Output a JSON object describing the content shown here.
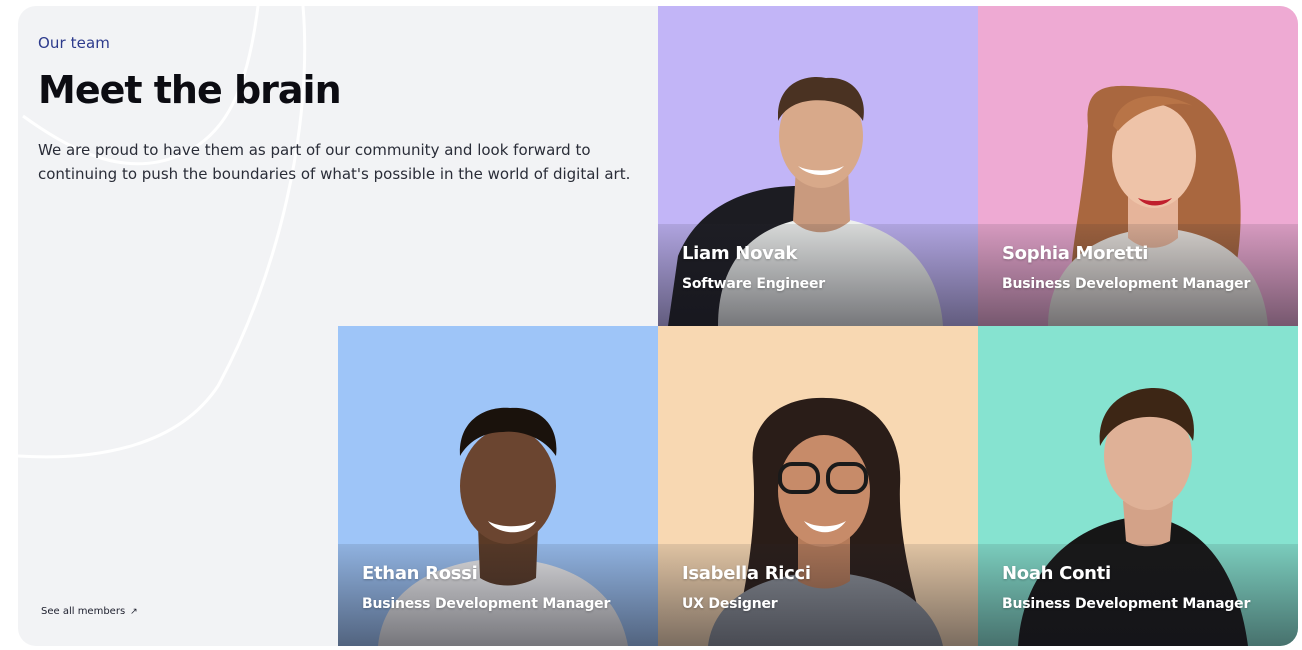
{
  "section": {
    "eyebrow": "Our team",
    "title": "Meet the brain",
    "description": "We are proud to have them as part of our community and look forward to continuing to push the boundaries of what's possible in the world of digital art.",
    "see_all_label": "See all members",
    "see_all_icon": "arrow-up-right-icon"
  },
  "members": [
    {
      "name": "Liam Novak",
      "role": "Software Engineer",
      "bg": "#c2b5f7"
    },
    {
      "name": "Sophia Moretti",
      "role": "Business Development Manager",
      "bg": "#eeaad3"
    },
    {
      "name": "Ethan Rossi",
      "role": "Business Development Manager",
      "bg": "#9ec5f8"
    },
    {
      "name": "Isabella Ricci",
      "role": "UX Designer",
      "bg": "#f8d8b2"
    },
    {
      "name": "Noah Conti",
      "role": "Business Development Manager",
      "bg": "#86e3d0"
    }
  ],
  "colors": {
    "panel": "#f2f3f5",
    "eyebrow": "#2c3a8c",
    "title": "#0c0c12"
  }
}
